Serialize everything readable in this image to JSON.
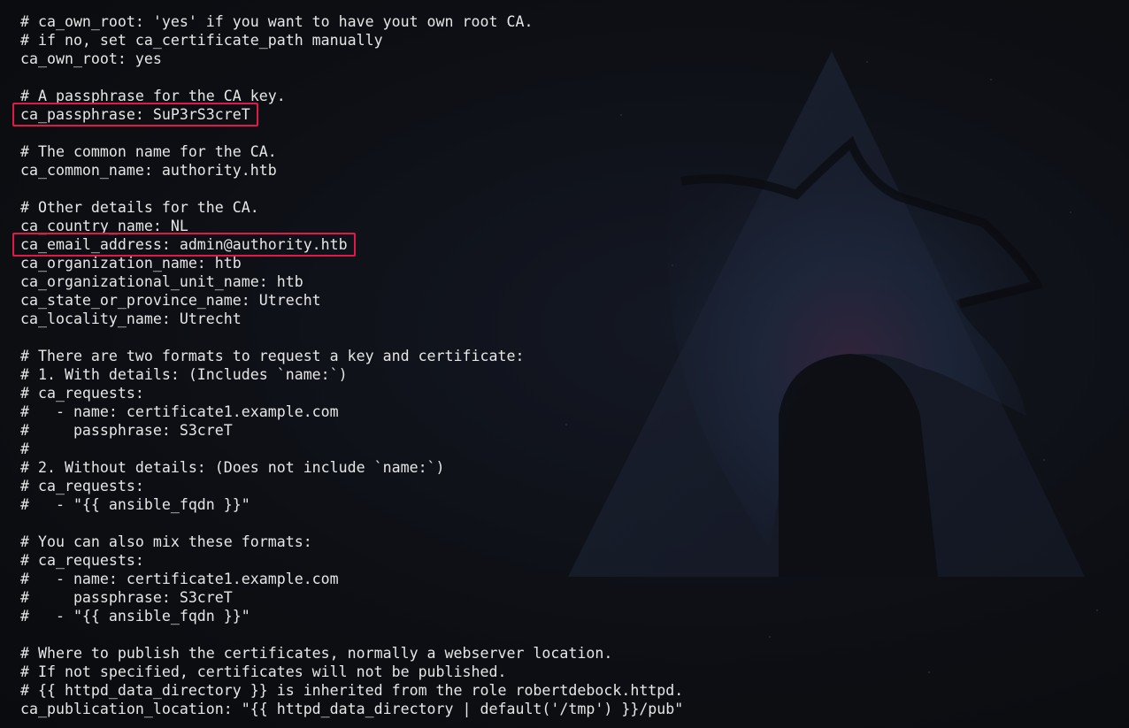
{
  "terminal": {
    "lines": [
      "# ca_own_root: 'yes' if you want to have yout own root CA.",
      "# if no, set ca_certificate_path manually",
      "ca_own_root: yes",
      "",
      "# A passphrase for the CA key.",
      "ca_passphrase: SuP3rS3creT",
      "",
      "# The common name for the CA.",
      "ca_common_name: authority.htb",
      "",
      "# Other details for the CA.",
      "ca_country_name: NL",
      "ca_email_address: admin@authority.htb",
      "ca_organization_name: htb",
      "ca_organizational_unit_name: htb",
      "ca_state_or_province_name: Utrecht",
      "ca_locality_name: Utrecht",
      "",
      "# There are two formats to request a key and certificate:",
      "# 1. With details: (Includes `name:`)",
      "# ca_requests:",
      "#   - name: certificate1.example.com",
      "#     passphrase: S3creT",
      "#",
      "# 2. Without details: (Does not include `name:`)",
      "# ca_requests:",
      "#   - \"{{ ansible_fqdn }}\"",
      "",
      "# You can also mix these formats:",
      "# ca_requests:",
      "#   - name: certificate1.example.com",
      "#     passphrase: S3creT",
      "#   - \"{{ ansible_fqdn }}\"",
      "",
      "# Where to publish the certificates, normally a webserver location.",
      "# If not specified, certificates will not be published.",
      "# {{ httpd_data_directory }} is inherited from the role robertdebock.httpd.",
      "ca_publication_location: \"{{ httpd_data_directory | default('/tmp') }}/pub\""
    ],
    "highlighted_lines": [
      5,
      12
    ],
    "highlight_color": "#e0194a",
    "text_color": "#e6e6e6",
    "background_color": "#0c0d10"
  },
  "wallpaper": {
    "icon": "kali-dragon-triangle-logo"
  }
}
